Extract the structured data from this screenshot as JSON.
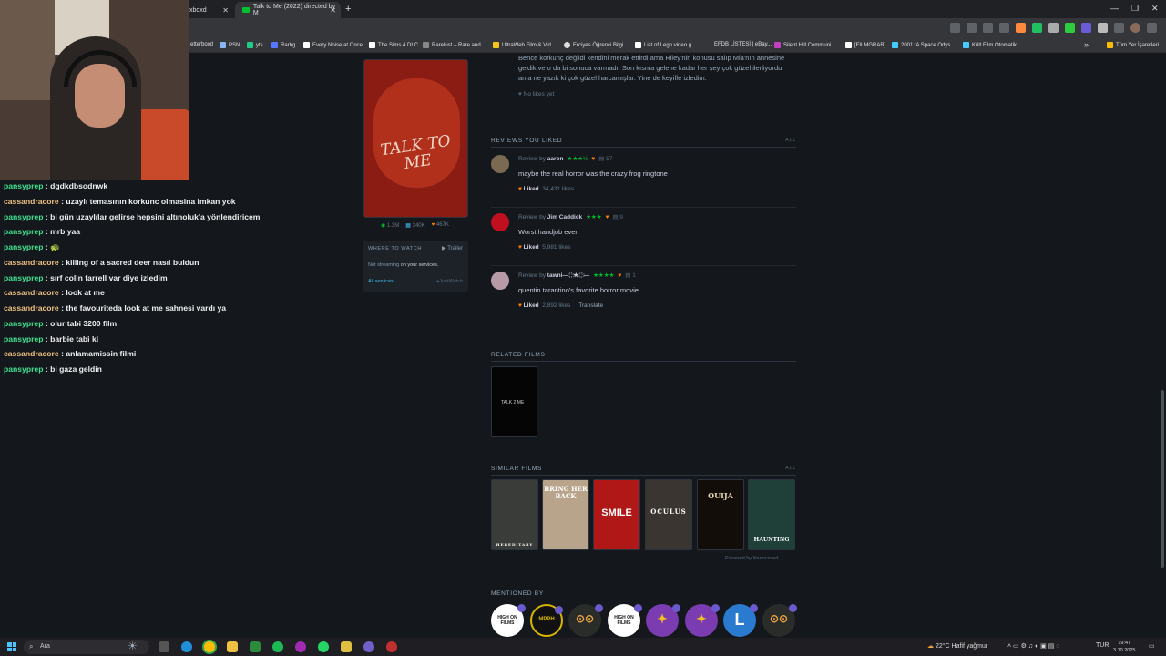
{
  "browser": {
    "tabs": [
      {
        "label": "xboxd"
      },
      {
        "label": "Talk to Me (2022) directed by M"
      }
    ],
    "new_tab": "+",
    "close": "✕",
    "bookmarks": [
      "etterboxd",
      "PSN",
      "yts",
      "Rarbg",
      "Every Noise at Once",
      "The Sims 4 DLC",
      "Rarelust – Rare and...",
      "UltraWeb Film & Vid...",
      "Erciyes Öğrenci Bilgi...",
      "List of Lego video g...",
      "EFDB LİSTESİ | eBay...",
      "Silent Hill Communi...",
      "[FILMGRAB]",
      "2001: A Space Odys...",
      "Kült Film Otomatik..."
    ],
    "bookmarks_more": "»",
    "all_bookmarks": "Tüm Yer İşaretleri"
  },
  "chat": [
    {
      "user": "pansyprep",
      "text": "dgdkdbsodnwk",
      "color": "green"
    },
    {
      "user": "cassandracore",
      "text": "uzaylı temasının korkunc olmasina imkan yok",
      "color": "orange"
    },
    {
      "user": "pansyprep",
      "text": "bi gün uzaylılar gelirse hepsini altınoluk'a yönlendiricem",
      "color": "green"
    },
    {
      "user": "pansyprep",
      "text": "mrb yaa",
      "color": "green"
    },
    {
      "user": "pansyprep",
      "text": "🐢",
      "color": "green"
    },
    {
      "user": "cassandracore",
      "text": "killing of a sacred deer nasıl buldun",
      "color": "orange"
    },
    {
      "user": "pansyprep",
      "text": "sırf colin farrell var diye izledim",
      "color": "green"
    },
    {
      "user": "cassandracore",
      "text": "look at me",
      "color": "orange"
    },
    {
      "user": "cassandracore",
      "text": "the favouriteda look at me sahnesi vardı ya",
      "color": "orange"
    },
    {
      "user": "pansyprep",
      "text": "olur tabi 3200 film",
      "color": "green"
    },
    {
      "user": "pansyprep",
      "text": "barbie tabi ki",
      "color": "green"
    },
    {
      "user": "cassandracore",
      "text": "anlamamissin filmi",
      "color": "orange"
    },
    {
      "user": "pansyprep",
      "text": "bi gaza geldin",
      "color": "green"
    }
  ],
  "film": {
    "poster_title": "TALK TO ME",
    "stats": {
      "watched": "1.3M",
      "lists": "240K",
      "likes": "467K"
    },
    "where_to_watch": {
      "heading": "WHERE TO WATCH",
      "trailer": "Trailer",
      "not_streaming": "Not streaming",
      "on_services": " on your services.",
      "all_services": "All services...",
      "provider": "JustWatch"
    }
  },
  "top_review": {
    "text": "Bence korkunç değildi kendini merak ettirdi ama Riley'nin konusu salıp Mia'nın annesine geldik ve o da bi sonuca varmadı. Son kısma gelene kadar her şey çok güzel ilerliyordu ama ne yazık ki çok güzel harcamışlar. Yine de keyifle izledim.",
    "likes": "No likes yet"
  },
  "reviews_section": {
    "title": "REVIEWS YOU LIKED",
    "all": "ALL"
  },
  "reviews": [
    {
      "prefix": "Review by",
      "author": "aaron",
      "stars": "★★★½",
      "comments": "57",
      "text": "maybe the real horror was the crazy frog ringtone",
      "liked": "Liked",
      "likes": "34,431 likes",
      "translate": ""
    },
    {
      "prefix": "Review by",
      "author": "Jim Caddick",
      "stars": "★★★",
      "comments": "9",
      "text": "Worst handjob ever",
      "liked": "Liked",
      "likes": "5,981 likes",
      "translate": ""
    },
    {
      "prefix": "Review by",
      "author": "tawni— ҉ ҈ ★ ҉ ҈ —",
      "stars": "★★★★",
      "comments": "1",
      "text": "quentin tarantino's favorite horror movie",
      "liked": "Liked",
      "likes": "2,892 likes",
      "translate": "Translate"
    }
  ],
  "related": {
    "title": "RELATED FILMS",
    "film": "TALK 2 ME"
  },
  "similar": {
    "title": "SIMILAR FILMS",
    "all": "ALL",
    "films": [
      "HEREDITARY",
      "BRING HER BACK",
      "SMILE",
      "OCULUS",
      "OUIJA",
      "HAUNTING"
    ],
    "powered": "Powered by Nanocrowd"
  },
  "mentioned": {
    "title": "MENTIONED BY",
    "items": [
      "HIGH ON FILMS",
      "MPPH",
      "",
      "HIGH ON FILMS",
      "",
      "",
      "L",
      ""
    ]
  },
  "taskbar": {
    "search": "Ara",
    "weather": "22°C  Hafif yağmur",
    "lang": "TUR",
    "time": "19:47",
    "date": "3.10.2025"
  }
}
